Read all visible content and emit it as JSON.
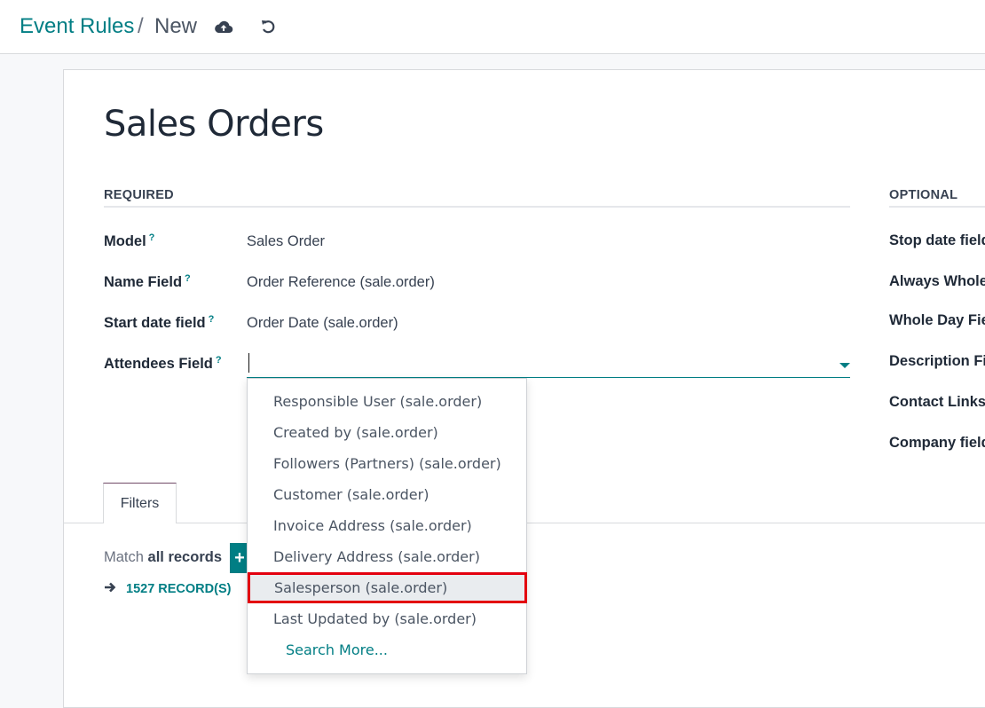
{
  "breadcrumb": {
    "root": "Event Rules",
    "separator": "/",
    "current": "New"
  },
  "toolbar": {
    "save_icon": "cloud-upload-icon",
    "discard_icon": "undo-icon"
  },
  "form": {
    "title": "Sales Orders",
    "required_section": "REQUIRED",
    "optional_section": "OPTIONAL",
    "help_marker": "?",
    "required_fields": [
      {
        "label": "Model",
        "value": "Sales Order"
      },
      {
        "label": "Name Field",
        "value": "Order Reference (sale.order)"
      },
      {
        "label": "Start date field",
        "value": "Order Date (sale.order)"
      },
      {
        "label": "Attendees Field",
        "value": ""
      }
    ],
    "optional_fields": [
      {
        "label": "Stop date field"
      },
      {
        "label": "Always Whole Day"
      },
      {
        "label": "Whole Day Field"
      },
      {
        "label": "Description Field"
      },
      {
        "label": "Contact Links"
      },
      {
        "label": "Company field"
      }
    ]
  },
  "dropdown": {
    "items": [
      "Responsible User (sale.order)",
      "Created by (sale.order)",
      "Followers (Partners) (sale.order)",
      "Customer (sale.order)",
      "Invoice Address (sale.order)",
      "Delivery Address (sale.order)",
      "Salesperson (sale.order)",
      "Last Updated by (sale.order)"
    ],
    "highlighted_index": 6,
    "search_more": "Search More..."
  },
  "notebook": {
    "tab_label": "Filters",
    "match_prefix": "Match",
    "match_bold": "all records",
    "add_button": "+",
    "records_link": "1527 RECORD(S)"
  },
  "colors": {
    "accent": "#017e84",
    "highlight_border": "#e3000f",
    "tab_top": "#714b67"
  }
}
